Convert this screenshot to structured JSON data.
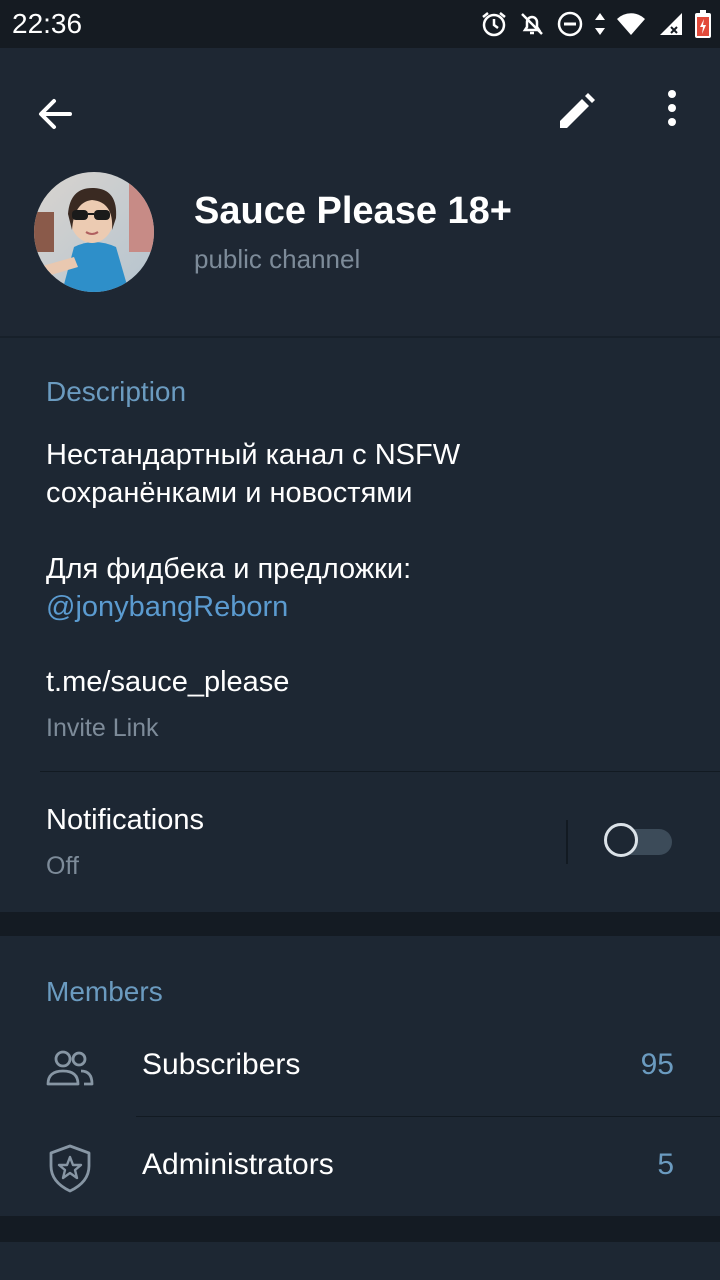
{
  "status_bar": {
    "time": "22:36"
  },
  "toolbar": {
    "back_icon": "arrow-left-icon",
    "edit_icon": "pencil-icon",
    "more_icon": "more-vertical-icon"
  },
  "channel": {
    "title": "Sauce Please 18+",
    "subtitle": "public channel"
  },
  "info": {
    "description_header": "Description",
    "description_line1": "Нестандартный канал с NSFW",
    "description_line2": "сохранёнками и новостями",
    "feedback_line": "Для фидбека и предложки:",
    "feedback_mention": "@jonybangReborn",
    "invite_link": "t.me/sauce_please",
    "invite_label": "Invite Link",
    "notifications_label": "Notifications",
    "notifications_value": "Off",
    "notifications_enabled": false
  },
  "members": {
    "header": "Members",
    "rows": [
      {
        "label": "Subscribers",
        "count": "95",
        "icon": "users-icon"
      },
      {
        "label": "Administrators",
        "count": "5",
        "icon": "shield-star-icon"
      }
    ]
  },
  "colors": {
    "background": "#1d2733",
    "accent": "#6b9bc0",
    "link": "#5b9bd0",
    "muted": "#7d8b99"
  }
}
